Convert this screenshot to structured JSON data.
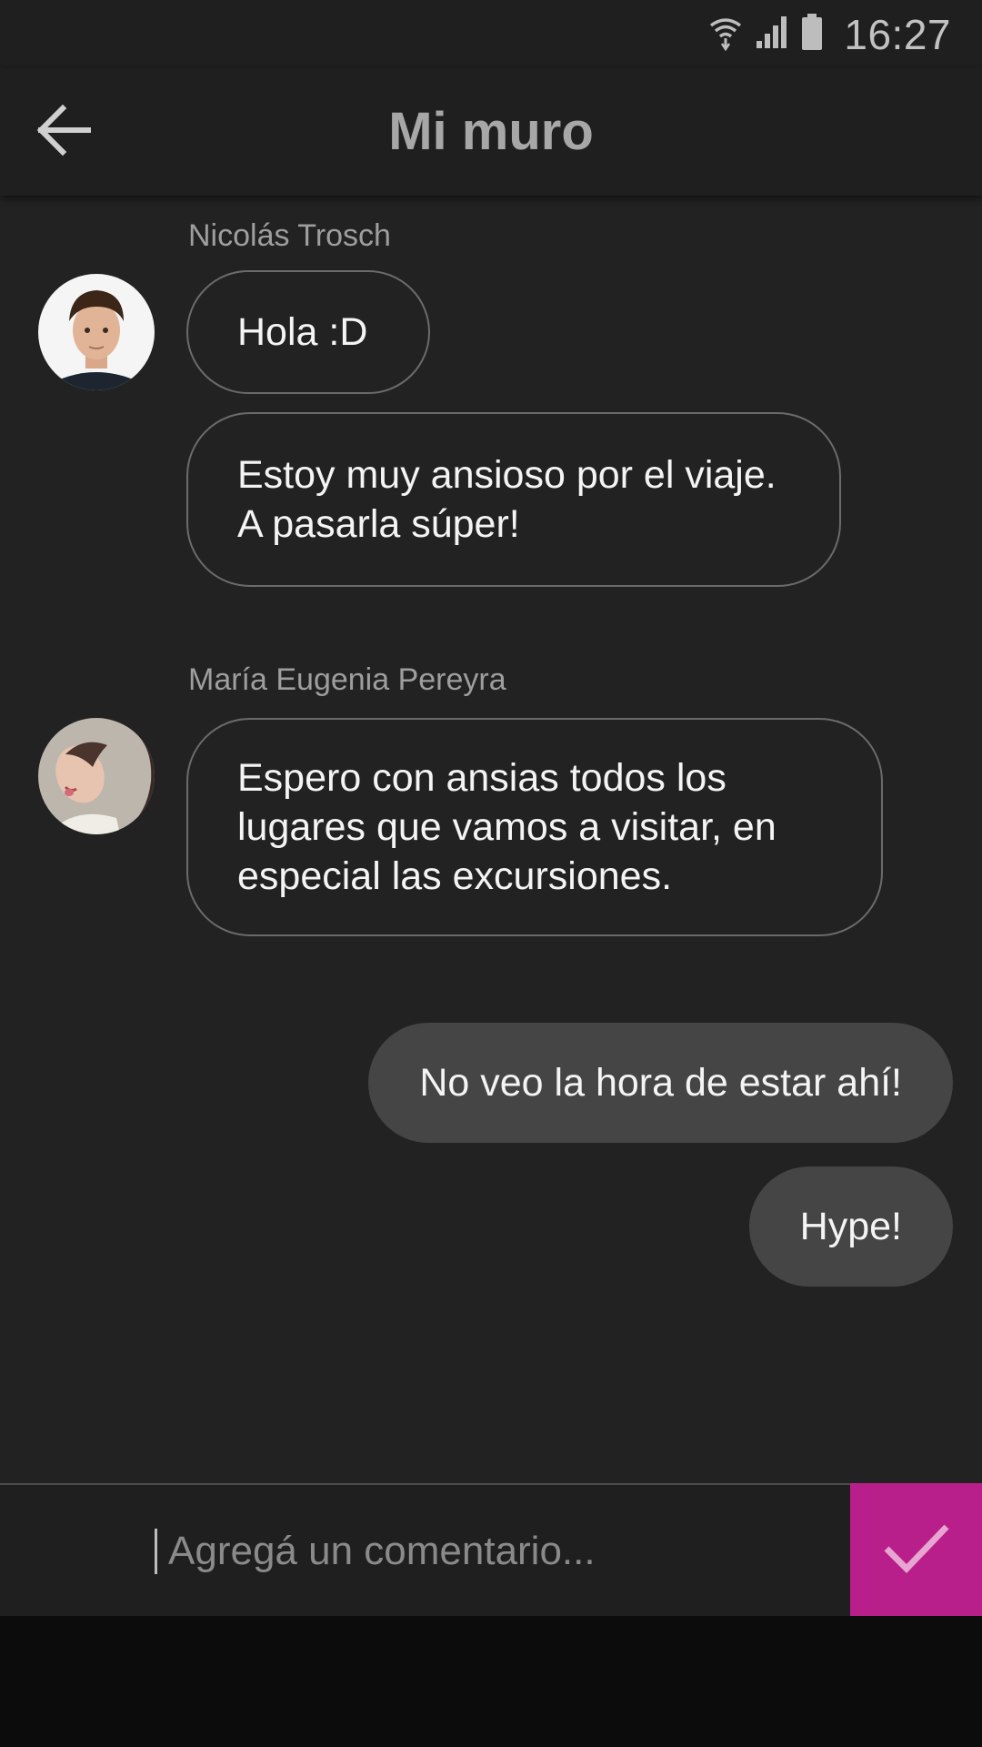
{
  "status_bar": {
    "time": "16:27",
    "icons": [
      "wifi-icon",
      "signal-icon",
      "battery-icon"
    ]
  },
  "app_bar": {
    "title": "Mi muro",
    "back_icon": "arrow-left-icon"
  },
  "messages": [
    {
      "sender": "Nicolás Trosch",
      "bubbles": [
        "Hola :D",
        "Estoy muy ansioso por el viaje.\nA pasarla súper!"
      ]
    },
    {
      "sender": "María Eugenia Pereyra",
      "bubbles": [
        "Espero con ansias todos los\nlugares que vamos a visitar, en\nespecial las excursiones."
      ]
    }
  ],
  "own_messages": [
    "No veo la hora de estar ahí!",
    "Hype!"
  ],
  "comment": {
    "placeholder": "Agregá un comentario...",
    "value": "",
    "send_icon": "checkmark-icon"
  },
  "colors": {
    "background": "#222222",
    "bar": "#1f1f1f",
    "accent": "#b81f8a",
    "own_bubble": "#454545",
    "bubble_border": "#6b6b6b"
  }
}
